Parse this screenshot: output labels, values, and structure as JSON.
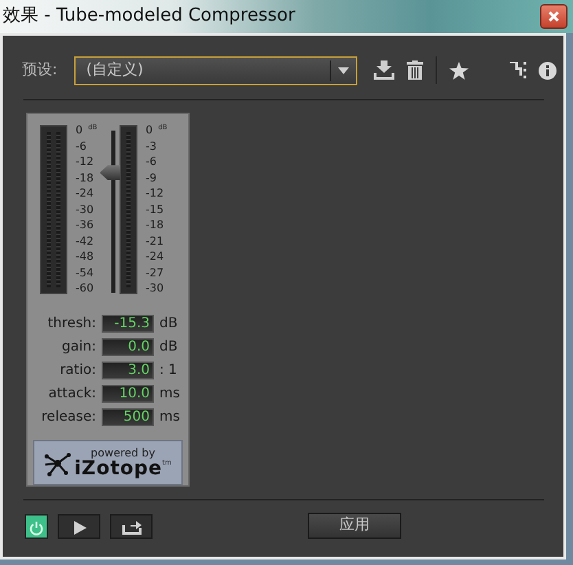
{
  "window": {
    "title": "效果 - Tube-modeled Compressor"
  },
  "preset": {
    "label": "预设:",
    "value": "(自定义)"
  },
  "meters": {
    "input_scale": [
      "0",
      "-6",
      "-12",
      "-18",
      "-24",
      "-30",
      "-36",
      "-42",
      "-48",
      "-54",
      "-60"
    ],
    "input_unit": "dB",
    "threshold_slider": {
      "level": 0.745
    },
    "reduction_scale": [
      "0",
      "-3",
      "-6",
      "-9",
      "-12",
      "-15",
      "-18",
      "-21",
      "-24",
      "-27",
      "-30"
    ],
    "reduction_unit": "dB"
  },
  "params": [
    {
      "label": "thresh:",
      "value": "-15.3",
      "unit": "dB"
    },
    {
      "label": "gain:",
      "value": "0.0",
      "unit": "dB"
    },
    {
      "label": "ratio:",
      "value": "3.0",
      "unit": ": 1"
    },
    {
      "label": "attack:",
      "value": "10.0",
      "unit": "ms"
    },
    {
      "label": "release:",
      "value": "500",
      "unit": "ms"
    }
  ],
  "logo": {
    "tagline": "powered by",
    "brand": "iZotope",
    "mark": "tm"
  },
  "footer": {
    "power_on": true,
    "apply_button": "应用"
  }
}
